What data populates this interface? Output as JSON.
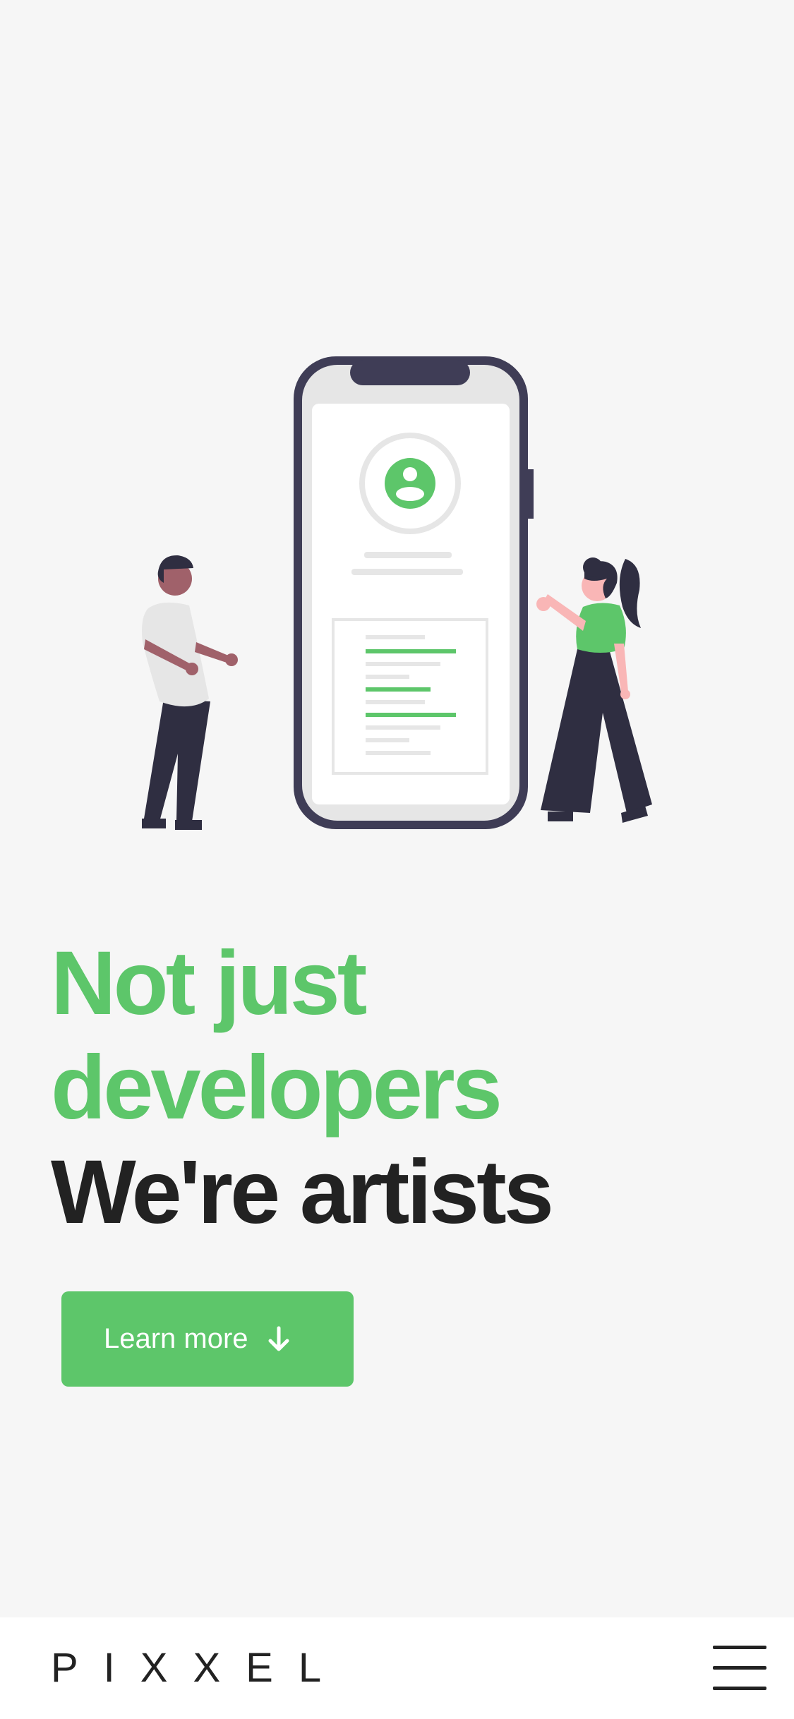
{
  "hero": {
    "headline_line1": "Not just",
    "headline_line2": "developers",
    "headline_line3": "We're artists",
    "cta_label": "Learn more",
    "cta_icon": "arrow-down-icon"
  },
  "illustration": {
    "description_icon": "phone-with-profile-illustration"
  },
  "footer": {
    "logo": "PIXXEL",
    "menu_icon": "hamburger-menu-icon"
  },
  "colors": {
    "accent": "#5dc66a",
    "text_dark": "#222222",
    "background": "#f6f6f6",
    "footer_bg": "#ffffff",
    "phone_frame": "#3f3d56"
  }
}
